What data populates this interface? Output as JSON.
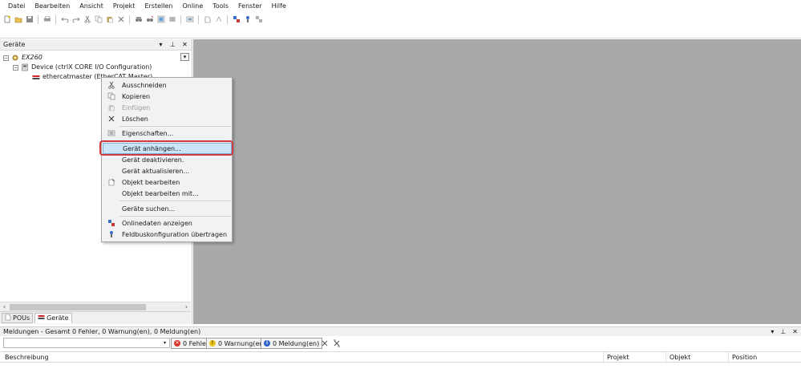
{
  "menubar": {
    "items": [
      "Datei",
      "Bearbeiten",
      "Ansicht",
      "Projekt",
      "Erstellen",
      "Online",
      "Tools",
      "Fenster",
      "Hilfe"
    ]
  },
  "devices_panel": {
    "title": "Geräte",
    "tree": [
      {
        "label": "EX260",
        "level": 0,
        "italic": true,
        "expanded": true
      },
      {
        "label": "Device (ctrlX CORE I/O Configuration)",
        "level": 1,
        "expanded": true
      },
      {
        "label": "ethercatmaster (EtherCAT Master)",
        "level": 2
      }
    ],
    "tabs": [
      {
        "label": "POUs",
        "active": false
      },
      {
        "label": "Geräte",
        "active": true
      }
    ]
  },
  "context_menu": {
    "items": [
      {
        "label": "Ausschneiden",
        "icon": "scissors-icon",
        "enabled": true
      },
      {
        "label": "Kopieren",
        "icon": "copy-icon",
        "enabled": true
      },
      {
        "label": "Einfügen",
        "icon": "paste-icon",
        "enabled": false
      },
      {
        "label": "Löschen",
        "icon": "delete-x-icon",
        "enabled": true
      },
      {
        "separator": true
      },
      {
        "label": "Eigenschaften...",
        "icon": "properties-icon",
        "enabled": true
      },
      {
        "separator": true
      },
      {
        "label": "Gerät anhängen...",
        "icon": "",
        "enabled": true,
        "highlighted": true
      },
      {
        "label": "Gerät deaktivieren.",
        "icon": "",
        "enabled": true
      },
      {
        "label": "Gerät aktualisieren...",
        "icon": "",
        "enabled": true
      },
      {
        "label": "Objekt bearbeiten",
        "icon": "edit-object-icon",
        "enabled": true
      },
      {
        "label": "Objekt bearbeiten mit...",
        "icon": "",
        "enabled": true
      },
      {
        "separator": true
      },
      {
        "label": "Geräte suchen...",
        "icon": "",
        "enabled": true
      },
      {
        "separator": true
      },
      {
        "label": "Onlinedaten anzeigen",
        "icon": "online-data-icon",
        "enabled": true
      },
      {
        "label": "Feldbuskonfiguration übertragen",
        "icon": "fieldbus-icon",
        "enabled": true
      }
    ]
  },
  "messages_panel": {
    "title": "Meldungen - Gesamt 0 Fehler, 0 Warnung(en), 0 Meldung(en)",
    "filters": {
      "errors": "0 Fehler",
      "warnings": "0 Warnung(en)",
      "messages": "0 Meldung(en)"
    },
    "columns": [
      "Beschreibung",
      "Projekt",
      "Objekt",
      "Position"
    ]
  },
  "colors": {
    "workspace": "#a9a9a9",
    "highlight": "#cce4f7",
    "callout": "#d1383f",
    "error": "#d9342b",
    "warning": "#e8c51a",
    "info": "#2a62c9"
  }
}
